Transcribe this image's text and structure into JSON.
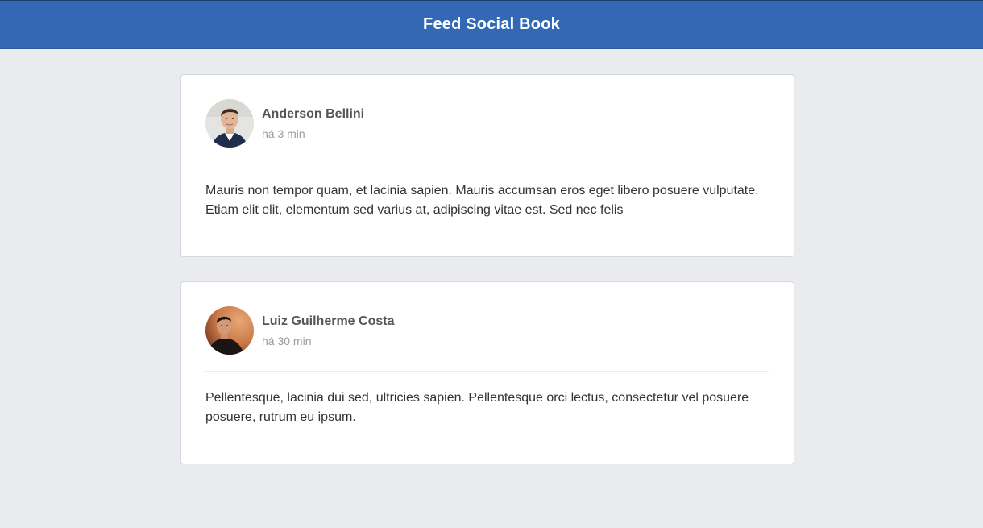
{
  "header": {
    "title": "Feed Social Book",
    "color": "#3368b4"
  },
  "posts": [
    {
      "author": "Anderson Bellini",
      "time": "há 3 min",
      "text": "Mauris non tempor quam, et lacinia sapien. Mauris accumsan eros eget libero posuere vulputate. Etiam elit elit, elementum sed varius at, adipiscing vitae est. Sed nec felis",
      "avatar_icon": "user-photo"
    },
    {
      "author": "Luiz Guilherme Costa",
      "time": "há 30 min",
      "text": "Pellentesque, lacinia dui sed, ultricies sapien. Pellentesque orci lectus, consectetur vel posuere posuere, rutrum eu ipsum.",
      "avatar_icon": "user-photo"
    }
  ]
}
